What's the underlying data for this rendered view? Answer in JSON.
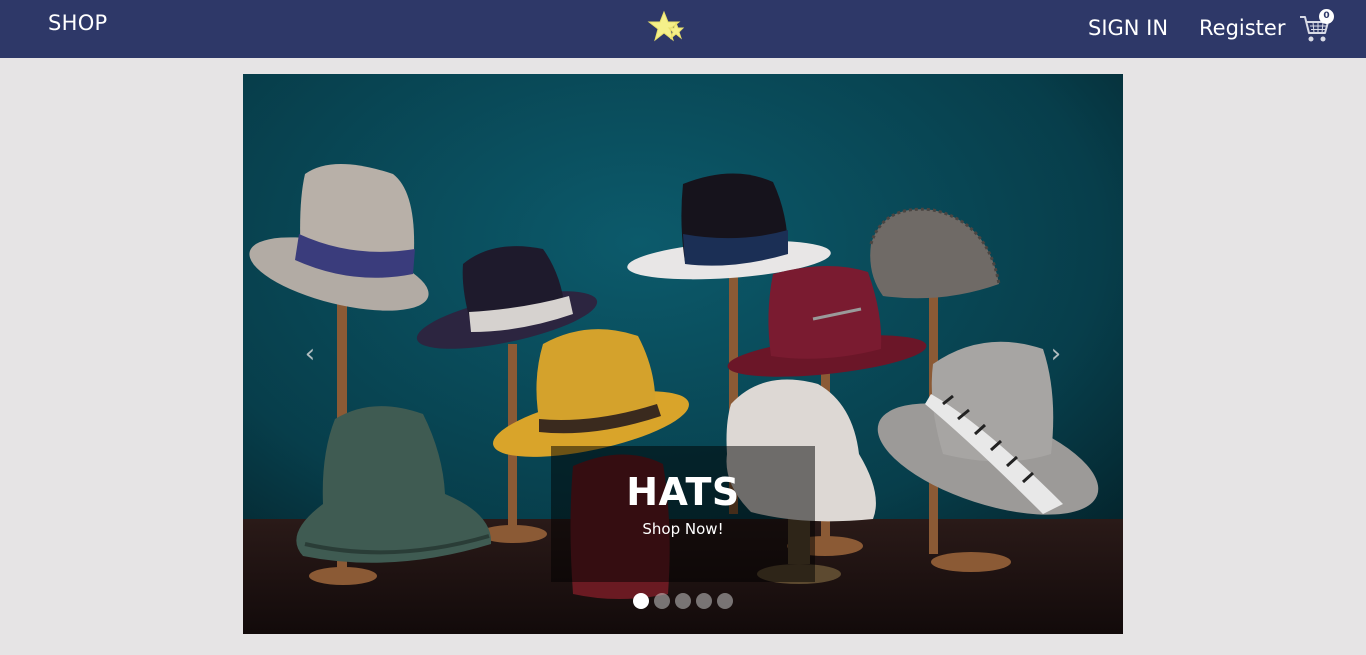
{
  "nav": {
    "brand": "SHOP",
    "logo_icon": "star-logo-icon",
    "sign_in": "SIGN IN",
    "register": "Register",
    "cart_icon": "shopping-cart-icon",
    "cart_count": "0"
  },
  "carousel": {
    "caption_title": "HATS",
    "caption_link": "Shop Now!",
    "prev_icon": "chevron-left-icon",
    "next_icon": "chevron-right-icon",
    "slide_count": 5,
    "active_index": 0
  },
  "colors": {
    "navbar": "#2e3868",
    "page_background": "#e6e4e5",
    "logo_star": "#f5f08a"
  }
}
